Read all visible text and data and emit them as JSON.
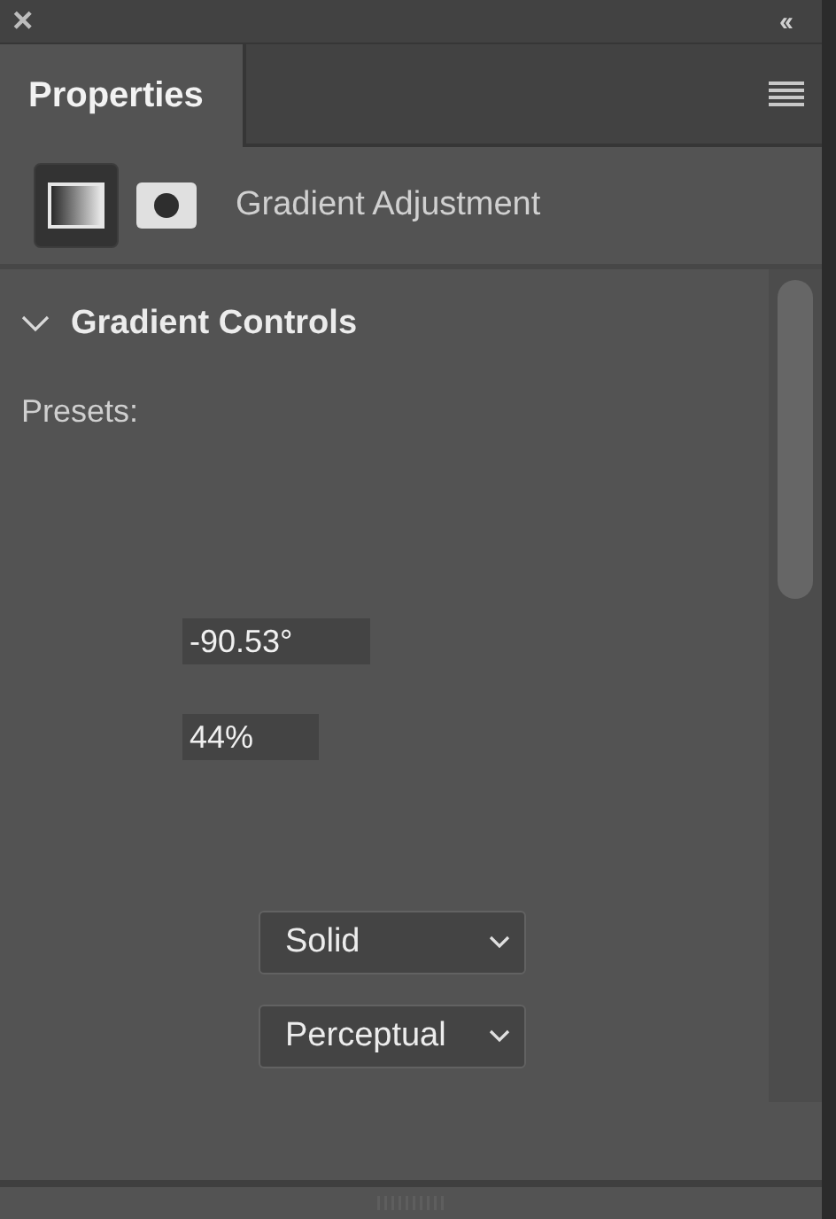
{
  "panel": {
    "close": "×",
    "collapse": "‹‹"
  },
  "tabs": [
    {
      "label": "Properties",
      "selected": true
    }
  ],
  "adjustment": {
    "modes": [
      {
        "kind": "gradient",
        "selected": true
      },
      {
        "kind": "mask",
        "selected": false
      }
    ],
    "title": "Gradient Adjustment"
  },
  "section": {
    "title": "Gradient Controls",
    "expanded": true,
    "presets_label": "Presets:",
    "fields": [
      {
        "value": "-90.53°",
        "kind": "wide"
      },
      {
        "value": "44%",
        "kind": "narrow"
      }
    ],
    "dropdowns": [
      {
        "value": "Solid"
      },
      {
        "value": "Perceptual"
      }
    ]
  }
}
